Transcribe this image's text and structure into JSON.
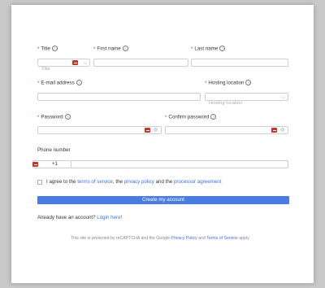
{
  "form": {
    "title": {
      "label": "Title",
      "placeholder": "Title"
    },
    "first_name": {
      "label": "First name"
    },
    "last_name": {
      "label": "Last name"
    },
    "email": {
      "label": "E-mail address"
    },
    "hosting": {
      "label": "Hosting location",
      "placeholder": "Hosting location"
    },
    "password": {
      "label": "Password"
    },
    "confirm_password": {
      "label": "Confirm password"
    },
    "phone": {
      "label": "Phone number",
      "country_code": "+1"
    },
    "agree": {
      "prefix": "I agree to the",
      "terms": "terms of service",
      "comma": ",",
      "the": "the",
      "privacy": "privacy policy",
      "and": "and the",
      "processor": "processor agreement"
    },
    "submit_label": "Create my account",
    "login_prompt": "Already have an account?",
    "login_link": "Login here!",
    "recaptcha": {
      "text1": "This site is protected by reCAPTCHA and the Google",
      "privacy": "Privacy Policy",
      "and": "and",
      "terms": "Terms of Service",
      "apply": "apply."
    }
  },
  "colors": {
    "accent": "#4a7be3",
    "link": "#3d6fe0",
    "required": "#e23b3b",
    "key_icon": "#c0392b"
  },
  "icons": {
    "help": "question-circle-icon",
    "dropdown": "chevron-down-icon",
    "password_manager": "key-icon",
    "visibility": "eye-icon"
  }
}
